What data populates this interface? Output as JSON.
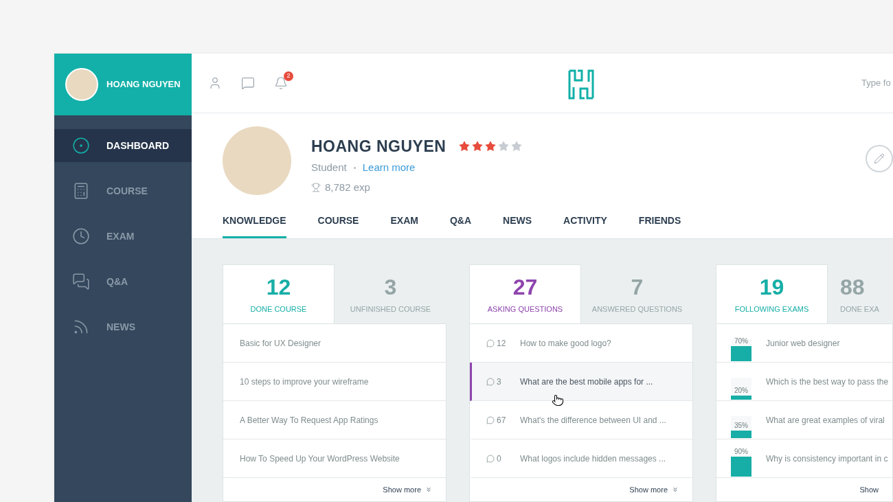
{
  "sidebar": {
    "user": {
      "name": "HOANG NGUYEN"
    },
    "items": [
      {
        "kind": "dashboard",
        "label": "DASHBOARD",
        "selected": true
      },
      {
        "kind": "course",
        "label": "COURSE",
        "selected": false
      },
      {
        "kind": "exam",
        "label": "EXAM",
        "selected": false
      },
      {
        "kind": "qa",
        "label": "Q&A",
        "selected": false
      },
      {
        "kind": "news",
        "label": "NEWS",
        "selected": false
      }
    ]
  },
  "header": {
    "notifications": {
      "badge": "2"
    },
    "search": {
      "placeholder": "Type fo"
    }
  },
  "profile": {
    "name": "HOANG NGUYEN",
    "stars": 3,
    "role": "Student",
    "link": "Learn more",
    "exp": "8,782 exp"
  },
  "tabs": [
    {
      "label": "KNOWLEDGE",
      "selected": true
    },
    {
      "label": "COURSE",
      "selected": false
    },
    {
      "label": "EXAM",
      "selected": false
    },
    {
      "label": "Q&A",
      "selected": false
    },
    {
      "label": "NEWS",
      "selected": false
    },
    {
      "label": "ACTIVITY",
      "selected": false
    },
    {
      "label": "FRIENDS",
      "selected": false
    }
  ],
  "panels": [
    {
      "kind": "courses",
      "tabs": [
        {
          "count": "12",
          "label": "DONE COURSE",
          "selected": true
        },
        {
          "count": "3",
          "label": "UNFINISHED COURSE",
          "selected": false
        }
      ],
      "rows": [
        {
          "title": "Basic for UX Designer"
        },
        {
          "title": "10 steps to improve your wireframe"
        },
        {
          "title": "A Better Way To Request App Ratings"
        },
        {
          "title": "How To Speed Up Your WordPress Website"
        }
      ],
      "show_more": "Show more"
    },
    {
      "kind": "questions",
      "tabs": [
        {
          "count": "27",
          "label": "ASKING QUESTIONS",
          "selected": true
        },
        {
          "count": "7",
          "label": "ANSWERED QUESTIONS",
          "selected": false
        }
      ],
      "rows": [
        {
          "replies": "12",
          "title": "How to make good logo?",
          "selected": false
        },
        {
          "replies": "3",
          "title": "What are the best mobile apps for ...",
          "selected": true
        },
        {
          "replies": "67",
          "title": "What's the difference between UI and ...",
          "selected": false
        },
        {
          "replies": "0",
          "title": "What logos include hidden messages ...",
          "selected": false
        }
      ],
      "show_more": "Show more"
    },
    {
      "kind": "exams",
      "tabs": [
        {
          "count": "19",
          "label": "FOLLOWING EXAMS",
          "selected": true
        },
        {
          "count": "88",
          "label": "DONE EXA",
          "selected": false
        }
      ],
      "rows": [
        {
          "percent": "70%",
          "level": 0.7,
          "title": "Junior web designer"
        },
        {
          "percent": "20%",
          "level": 0.2,
          "title": "Which is the best way to pass the"
        },
        {
          "percent": "35%",
          "level": 0.35,
          "title": "What are great examples of viral"
        },
        {
          "percent": "90%",
          "level": 0.9,
          "title": "Why is consistency important in c"
        }
      ],
      "show_more": "Show"
    }
  ]
}
